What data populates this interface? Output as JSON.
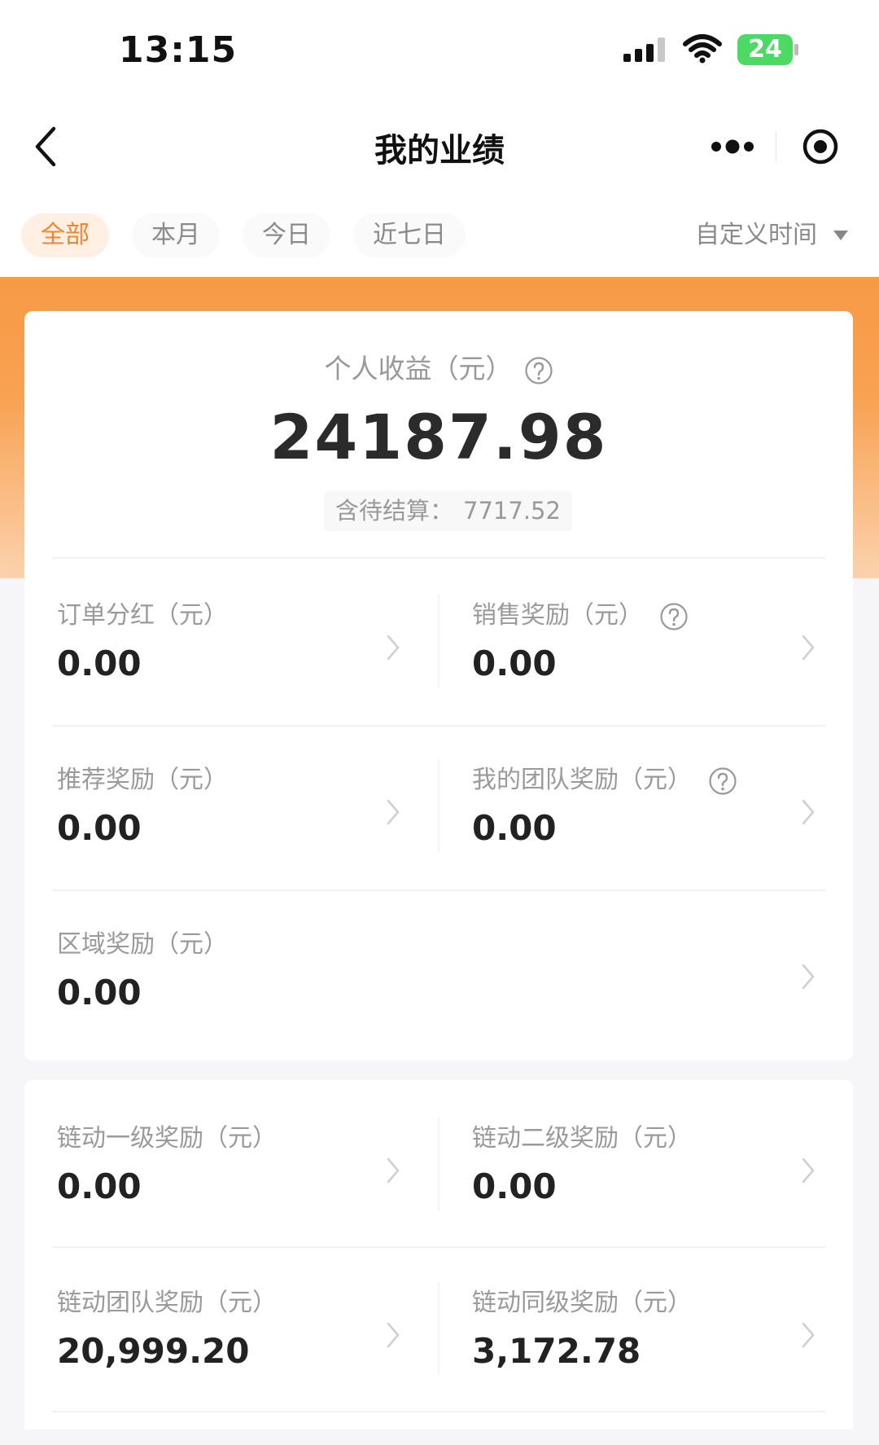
{
  "status_bar": {
    "time": "13:15",
    "battery": "24"
  },
  "nav": {
    "title": "我的业绩"
  },
  "tabs": [
    {
      "label": "全部",
      "active": true
    },
    {
      "label": "本月",
      "active": false
    },
    {
      "label": "今日",
      "active": false
    },
    {
      "label": "近七日",
      "active": false
    }
  ],
  "custom_time": "自定义时间",
  "summary": {
    "label": "个人收益（元）",
    "value": "24187.98",
    "pending_label": "含待结算：",
    "pending_value": "7717.52"
  },
  "rewards": [
    {
      "label": "订单分红（元）",
      "value": "0.00",
      "help": false
    },
    {
      "label": "销售奖励（元）",
      "value": "0.00",
      "help": true
    },
    {
      "label": "推荐奖励（元）",
      "value": "0.00",
      "help": false
    },
    {
      "label": "我的团队奖励（元）",
      "value": "0.00",
      "help": true
    },
    {
      "label": "区域奖励（元）",
      "value": "0.00",
      "help": false
    }
  ],
  "linked_rewards": [
    {
      "label": "链动一级奖励（元）",
      "value": "0.00"
    },
    {
      "label": "链动二级奖励（元）",
      "value": "0.00"
    },
    {
      "label": "链动团队奖励（元）",
      "value": "20,999.20"
    },
    {
      "label": "链动同级奖励（元）",
      "value": "3,172.78"
    }
  ],
  "colors": {
    "accent": "#f08530",
    "banner": "#f79a45",
    "battery": "#4cd964"
  }
}
